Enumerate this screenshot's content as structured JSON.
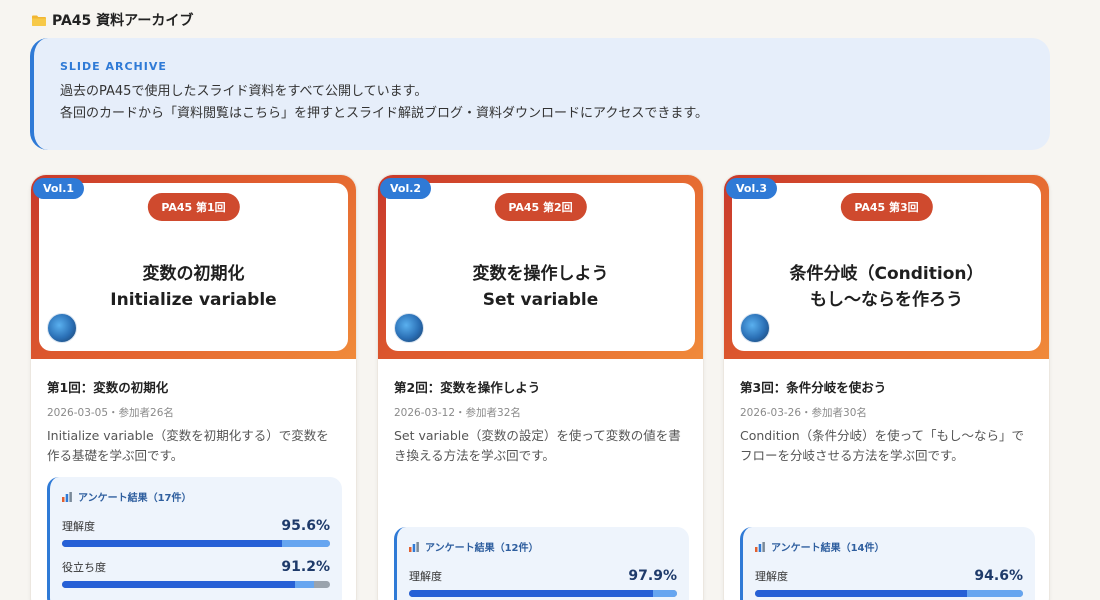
{
  "header": {
    "icon": "folder-icon",
    "title": "PA45 資料アーカイブ"
  },
  "intro": {
    "kicker": "SLIDE ARCHIVE",
    "line1": "過去のPA45で使用したスライド資料をすべて公開しています。",
    "line2": "各回のカードから「資料閲覧はこちら」を押すとスライド解説ブログ・資料ダウンロードにアクセスできます。"
  },
  "colors": {
    "accent": "#2f7ad6",
    "session_pill": "#cf4a2e",
    "bar_main": "#2660d6",
    "bar_soft": "#66a5f0"
  },
  "cards": [
    {
      "vol": "Vol.1",
      "session": "PA45 第1回",
      "thumb_title_1": "変数の初期化",
      "thumb_title_2": "Initialize variable",
      "title": "第1回：変数の初期化",
      "meta": "2026-03-05・参加者26名",
      "desc": "Initialize variable（変数を初期化する）で変数を作る基礎を学ぶ回です。",
      "survey": {
        "heading": "アンケート結果（17件）",
        "metrics": [
          {
            "label": "理解度",
            "value": "95.6%",
            "main": 0.82,
            "soft": 0.18
          },
          {
            "label": "役立ち度",
            "value": "91.2%",
            "main": 0.87,
            "soft": 0.07
          }
        ]
      }
    },
    {
      "vol": "Vol.2",
      "session": "PA45 第2回",
      "thumb_title_1": "変数を操作しよう",
      "thumb_title_2": "Set variable",
      "title": "第2回：変数を操作しよう",
      "meta": "2026-03-12・参加者32名",
      "desc": "Set variable（変数の設定）を使って変数の値を書き換える方法を学ぶ回です。",
      "survey": {
        "heading": "アンケート結果（12件）",
        "metrics": [
          {
            "label": "理解度",
            "value": "97.9%",
            "main": 0.91,
            "soft": 0.09
          }
        ]
      }
    },
    {
      "vol": "Vol.3",
      "session": "PA45 第3回",
      "thumb_title_1": "条件分岐（Condition）",
      "thumb_title_2": "もし〜ならを作ろう",
      "title": "第3回：条件分岐を使おう",
      "meta": "2026-03-26・参加者30名",
      "desc": "Condition（条件分岐）を使って「もし〜なら」でフローを分岐させる方法を学ぶ回です。",
      "survey": {
        "heading": "アンケート結果（14件）",
        "metrics": [
          {
            "label": "理解度",
            "value": "94.6%",
            "main": 0.79,
            "soft": 0.21
          }
        ]
      }
    }
  ]
}
